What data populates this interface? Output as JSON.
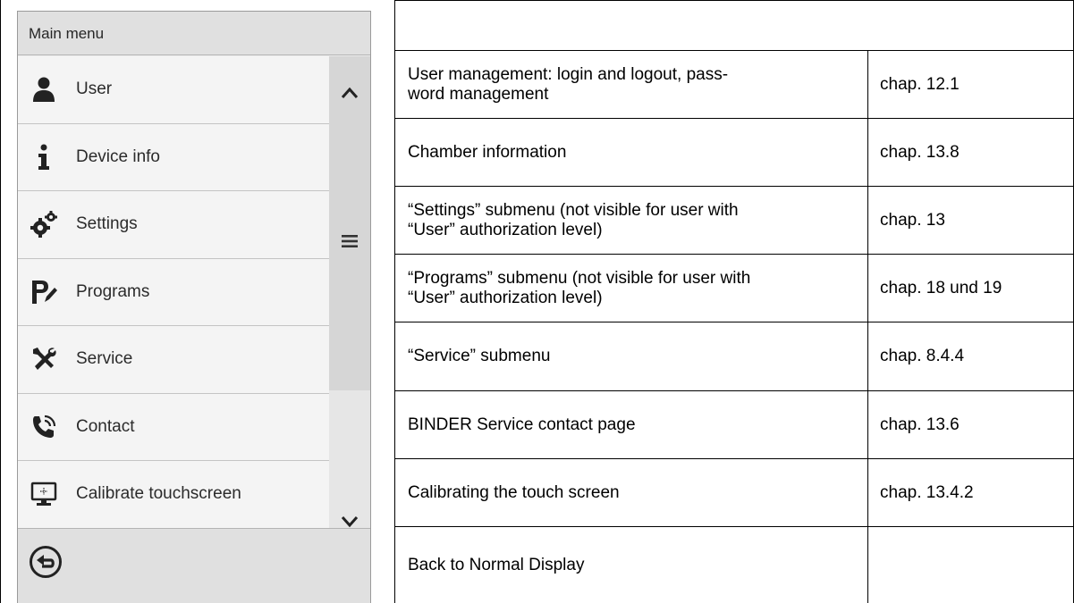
{
  "screen": {
    "title": "Main menu",
    "menu_items": [
      {
        "label": "User",
        "icon": "user-icon"
      },
      {
        "label": "Device info",
        "icon": "info-icon"
      },
      {
        "label": "Settings",
        "icon": "gears-icon"
      },
      {
        "label": "Programs",
        "icon": "programs-icon"
      },
      {
        "label": "Service",
        "icon": "service-tools-icon"
      },
      {
        "label": "Contact",
        "icon": "phone-icon"
      },
      {
        "label": "Calibrate touchscreen",
        "icon": "touchscreen-icon"
      }
    ],
    "scrollbar": {
      "up_icon": "chevron-up-icon",
      "down_icon": "chevron-down-icon",
      "grip_icon": "hamburger-icon"
    },
    "footer": {
      "back_icon": "back-arrow-icon"
    }
  },
  "table": {
    "rows": [
      {
        "description": "User management: login and logout, pass-\nword management",
        "chapter": "chap. 12.1"
      },
      {
        "description": "Chamber information",
        "chapter": "chap. 13.8"
      },
      {
        "description": "“Settings” submenu (not visible for user with\n“User” authorization level)",
        "chapter": "chap. 13"
      },
      {
        "description": "“Programs” submenu (not visible for user with\n“User” authorization level)",
        "chapter": "chap. 18 und 19"
      },
      {
        "description": "“Service” submenu",
        "chapter": "chap. 8.4.4"
      },
      {
        "description": "BINDER Service contact page",
        "chapter": "chap. 13.6"
      },
      {
        "description": "Calibrating the touch screen",
        "chapter": "chap. 13.4.2"
      },
      {
        "description": "Back to Normal Display",
        "chapter": ""
      }
    ]
  },
  "colors": {
    "screen_bg": "#ececec",
    "header_bg": "#e0e0e0",
    "item_bg": "#f4f4f4",
    "icon": "#222222"
  }
}
